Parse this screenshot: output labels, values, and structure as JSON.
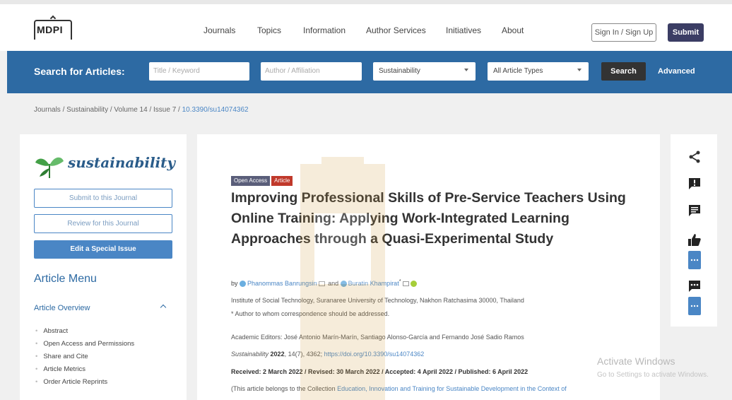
{
  "header": {
    "logo_text": "MDPI",
    "nav": [
      "Journals",
      "Topics",
      "Information",
      "Author Services",
      "Initiatives",
      "About"
    ],
    "signin_label": "Sign In / Sign Up",
    "submit_label": "Submit"
  },
  "search": {
    "label": "Search for Articles:",
    "title_placeholder": "Title / Keyword",
    "author_placeholder": "Author / Affiliation",
    "journal_value": "Sustainability",
    "type_value": "All Article Types",
    "search_label": "Search",
    "advanced_label": "Advanced"
  },
  "breadcrumb": {
    "items": [
      "Journals",
      "Sustainability",
      "Volume 14",
      "Issue 7"
    ],
    "doi": "10.3390/su14074362"
  },
  "sidebar": {
    "journal_name": "sustainability",
    "submit_label": "Submit to this Journal",
    "review_label": "Review for this Journal",
    "edit_label": "Edit a Special Issue",
    "menu_title": "Article Menu",
    "overview_label": "Article Overview",
    "items": [
      "Abstract",
      "Open Access and Permissions",
      "Share and Cite",
      "Article Metrics",
      "Order Article Reprints"
    ]
  },
  "article": {
    "badge_oa": "Open Access",
    "badge_article": "Article",
    "title": "Improving Professional Skills of Pre-Service Teachers Using Online Training: Applying Work-Integrated Learning Approaches through a Quasi-Experimental Study",
    "by": "by",
    "author1": "Phanommas Banrungsin",
    "and": "and",
    "author2": "Buratin Khampirat",
    "author2_mark": "*",
    "affiliation": "Institute of Social Technology, Suranaree University of Technology, Nakhon Ratchasima 30000, Thailand",
    "correspondence": "*   Author to whom correspondence should be addressed.",
    "editors": "Academic Editors: José Antonio Marín-Marín, Santiago Alonso-García and Fernando José Sadio Ramos",
    "citation_journal": "Sustainability",
    "citation_year": "2022",
    "citation_rest": ", 14(7), 4362;",
    "citation_doi": "https://doi.org/10.3390/su14074362",
    "dates": "Received: 2 March 2022 / Revised: 30 March 2022 / Accepted: 4 April 2022 / Published: 6 April 2022",
    "collection_prefix": "(This article belongs to the Collection",
    "collection_link": "Education, Innovation and Training for Sustainable Development in the Context of"
  },
  "tools": [
    "share-icon",
    "alert-icon",
    "comment-icon",
    "thumbs-up-icon",
    "more-icon"
  ],
  "watermark": {
    "line1": "Activate Windows",
    "line2": "Go to Settings to activate Windows."
  }
}
